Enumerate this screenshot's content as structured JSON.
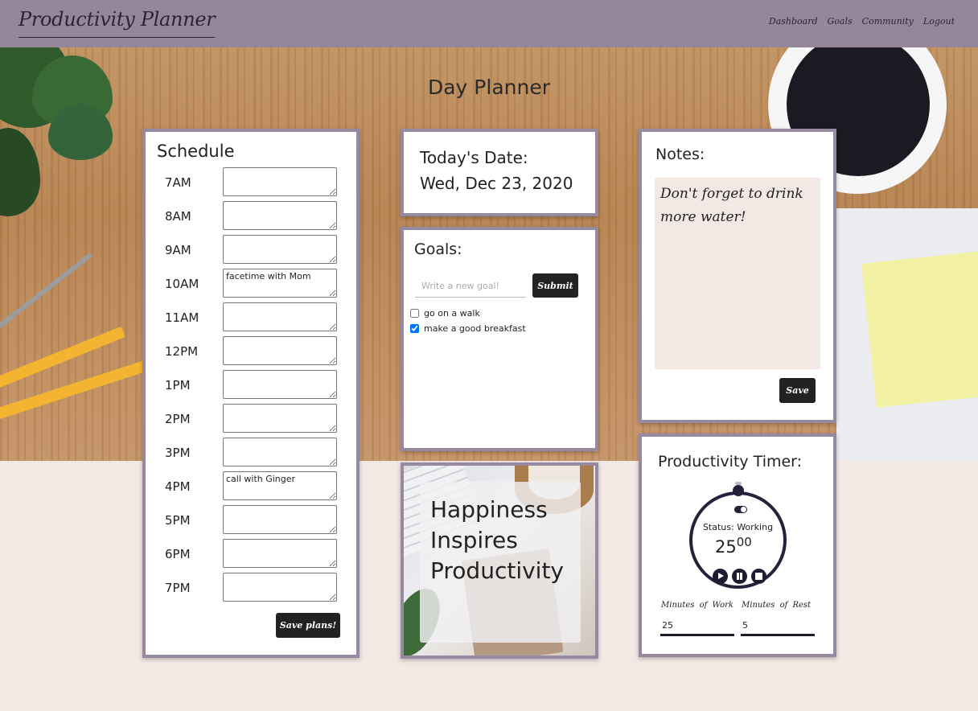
{
  "nav": {
    "brand": "Productivity Planner",
    "links": [
      "Dashboard",
      "Goals",
      "Community",
      "Logout"
    ]
  },
  "page_title": "Day Planner",
  "schedule": {
    "title": "Schedule",
    "slots": [
      {
        "hour": "7AM",
        "value": ""
      },
      {
        "hour": "8AM",
        "value": ""
      },
      {
        "hour": "9AM",
        "value": ""
      },
      {
        "hour": "10AM",
        "value": "facetime with Mom"
      },
      {
        "hour": "11AM",
        "value": ""
      },
      {
        "hour": "12PM",
        "value": ""
      },
      {
        "hour": "1PM",
        "value": ""
      },
      {
        "hour": "2PM",
        "value": ""
      },
      {
        "hour": "3PM",
        "value": ""
      },
      {
        "hour": "4PM",
        "value": "call with Ginger"
      },
      {
        "hour": "5PM",
        "value": ""
      },
      {
        "hour": "6PM",
        "value": ""
      },
      {
        "hour": "7PM",
        "value": ""
      }
    ],
    "save_label": "Save plans!"
  },
  "date": {
    "label": "Today's Date:",
    "value": "Wed, Dec 23, 2020"
  },
  "goals": {
    "title": "Goals:",
    "placeholder": "Write a new goal!",
    "submit_label": "Submit",
    "items": [
      {
        "text": "go on a walk",
        "checked": false
      },
      {
        "text": "make a good breakfast",
        "checked": true
      }
    ]
  },
  "quote": {
    "text": "Happiness Inspires Productivity"
  },
  "notes": {
    "title": "Notes:",
    "text": "Don't forget to drink more water!",
    "save_label": "Save"
  },
  "timer": {
    "title": "Productivity Timer:",
    "status": "Status: Working",
    "minutes": "25",
    "seconds": "00",
    "work_label": "Minutes of Work",
    "work_value": "25",
    "rest_label": "Minutes of Rest",
    "rest_value": "5"
  }
}
